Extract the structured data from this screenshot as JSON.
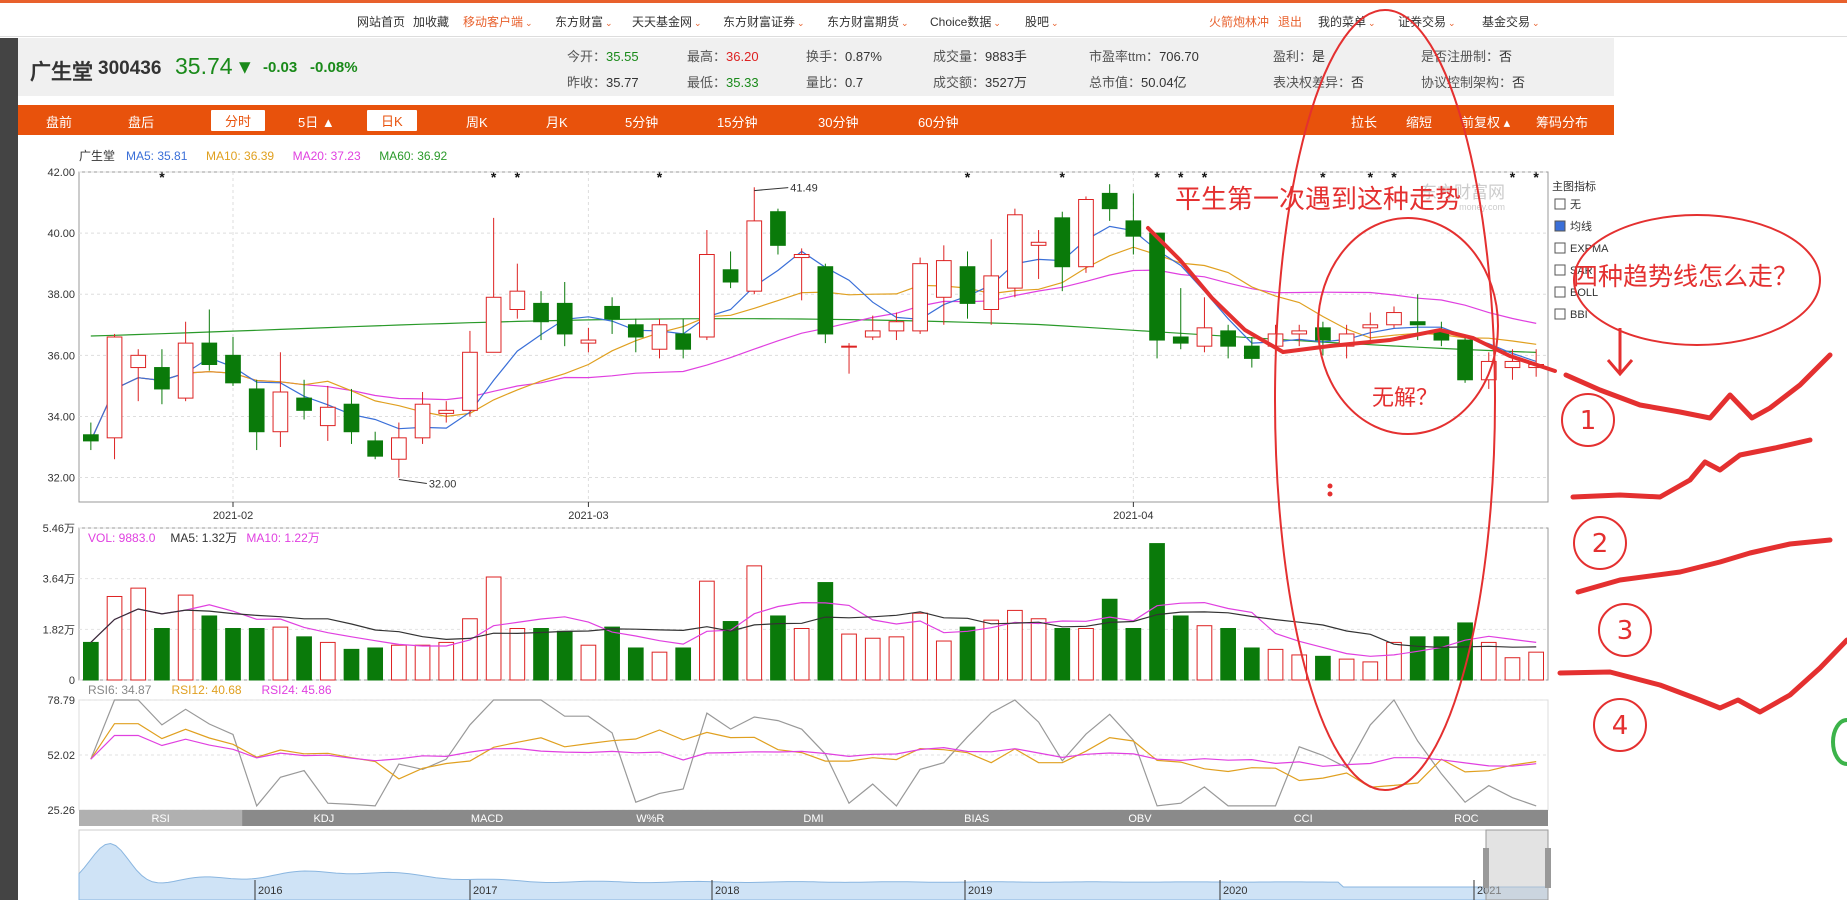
{
  "nav": {
    "items": [
      {
        "label": "网站首页",
        "x": 357
      },
      {
        "label": "加收藏",
        "x": 413
      },
      {
        "label": "移动客户端",
        "x": 463,
        "hot": true,
        "caret": true
      },
      {
        "label": "东方财富",
        "x": 555,
        "caret": true
      },
      {
        "label": "天天基金网",
        "x": 632,
        "caret": true
      },
      {
        "label": "东方财富证券",
        "x": 723,
        "caret": true
      },
      {
        "label": "东方财富期货",
        "x": 827,
        "caret": true
      },
      {
        "label": "Choice数据",
        "x": 930,
        "caret": true
      },
      {
        "label": "股吧",
        "x": 1025,
        "caret": true
      },
      {
        "label": "火箭炮林冲",
        "x": 1209,
        "hot": true
      },
      {
        "label": "退出",
        "x": 1278,
        "hot": true
      },
      {
        "label": "我的菜单",
        "x": 1318,
        "caret": true
      },
      {
        "label": "证券交易",
        "x": 1398,
        "caret": true
      },
      {
        "label": "基金交易",
        "x": 1482,
        "caret": true
      }
    ]
  },
  "quote": {
    "name": "广生堂",
    "code": "300436",
    "price": "35.74",
    "change": "-0.03",
    "change_pct": "-0.08%",
    "fields": [
      {
        "label": "今开：",
        "value": "35.55",
        "color": "green",
        "col": 0,
        "row": 0
      },
      {
        "label": "昨收：",
        "value": "35.77",
        "color": "",
        "col": 0,
        "row": 1
      },
      {
        "label": "最高：",
        "value": "36.20",
        "color": "red",
        "col": 1,
        "row": 0
      },
      {
        "label": "最低：",
        "value": "35.33",
        "color": "green",
        "col": 1,
        "row": 1
      },
      {
        "label": "换手：",
        "value": "0.87%",
        "color": "",
        "col": 2,
        "row": 0
      },
      {
        "label": "量比：",
        "value": "0.7",
        "color": "",
        "col": 2,
        "row": 1
      },
      {
        "label": "成交量：",
        "value": "9883手",
        "color": "",
        "col": 3,
        "row": 0
      },
      {
        "label": "成交额：",
        "value": "3527万",
        "color": "",
        "col": 3,
        "row": 1
      },
      {
        "label": "市盈率ttm：",
        "value": "706.70",
        "color": "",
        "col": 4,
        "row": 0
      },
      {
        "label": "总市值：",
        "value": "50.04亿",
        "color": "",
        "col": 4,
        "row": 1
      },
      {
        "label": "盈利：",
        "value": "是",
        "color": "",
        "col": 5,
        "row": 0
      },
      {
        "label": "表决权差异：",
        "value": "否",
        "color": "",
        "col": 5,
        "row": 1
      },
      {
        "label": "是否注册制：",
        "value": "否",
        "color": "",
        "col": 6,
        "row": 0
      },
      {
        "label": "协议控制架构：",
        "value": "否",
        "color": "",
        "col": 6,
        "row": 1
      }
    ]
  },
  "tabs": [
    {
      "label": "盘前",
      "x": 28
    },
    {
      "label": "盘后",
      "x": 110
    },
    {
      "label": "分时",
      "x": 193,
      "active": true
    },
    {
      "label": "5日 ▲",
      "x": 280
    },
    {
      "label": "日K",
      "x": 349,
      "active": true
    },
    {
      "label": "周K",
      "x": 448
    },
    {
      "label": "月K",
      "x": 528
    },
    {
      "label": "5分钟",
      "x": 607
    },
    {
      "label": "15分钟",
      "x": 699
    },
    {
      "label": "30分钟",
      "x": 800
    },
    {
      "label": "60分钟",
      "x": 900
    },
    {
      "label": "拉长",
      "x": 1333
    },
    {
      "label": "缩短",
      "x": 1388
    },
    {
      "label": "前复权 ▴",
      "x": 1443
    },
    {
      "label": "筹码分布",
      "x": 1518
    }
  ],
  "legend": {
    "name": "广生堂",
    "ma": [
      {
        "text": "MA5: 35.81",
        "color": "#3a6fd8"
      },
      {
        "text": "MA10: 36.39",
        "color": "#e0a020"
      },
      {
        "text": "MA20: 37.23",
        "color": "#e040e0"
      },
      {
        "text": "MA60: 36.92",
        "color": "#2a9a2a"
      }
    ],
    "vol": [
      {
        "text": "VOL: 9883.0",
        "color": "#e040e0"
      },
      {
        "text": "MA5: 1.32万",
        "color": "#333333"
      },
      {
        "text": "MA10: 1.22万",
        "color": "#e040e0"
      }
    ],
    "rsi": [
      {
        "text": "RSI6: 34.87",
        "color": "#888888"
      },
      {
        "text": "RSI12: 40.68",
        "color": "#e0a020"
      },
      {
        "text": "RSI24: 45.86",
        "color": "#e040e0"
      }
    ]
  },
  "side_panel": {
    "title": "主图指标",
    "options": [
      {
        "label": "无",
        "checked": false
      },
      {
        "label": "均线",
        "checked": true
      },
      {
        "label": "EXPMA",
        "checked": false
      },
      {
        "label": "SAR",
        "checked": false
      },
      {
        "label": "BOLL",
        "checked": false
      },
      {
        "label": "BBI",
        "checked": false
      }
    ]
  },
  "indicator_tabs": [
    "RSI",
    "KDJ",
    "MACD",
    "W%R",
    "DMI",
    "BIAS",
    "OBV",
    "CCI",
    "ROC"
  ],
  "overview_years": [
    "2016",
    "2017",
    "2018",
    "2019",
    "2020",
    "2021"
  ],
  "watermark": "东方财富网",
  "watermark_sub": "money.com",
  "annotations": {
    "top_text": "平生第一次遇到这种走势",
    "mid_text": "无解？",
    "question": "四种趋势线怎么走？",
    "nums": [
      "1",
      "2",
      "3",
      "4"
    ]
  },
  "chart_data": {
    "type": "candlestick",
    "x_labels": [
      "2021-02",
      "2021-03",
      "2021-04"
    ],
    "x_label_index": [
      6,
      21,
      44
    ],
    "price_axis": {
      "ticks": [
        32.0,
        34.0,
        36.0,
        38.0,
        40.0,
        42.0
      ],
      "ylim": [
        31.2,
        42.0
      ]
    },
    "high_label": "41.49",
    "low_label": "32.00",
    "candles": [
      [
        33.4,
        33.2,
        33.8,
        32.9
      ],
      [
        33.3,
        36.6,
        36.7,
        32.6
      ],
      [
        35.6,
        36.0,
        36.2,
        34.5
      ],
      [
        35.6,
        34.9,
        36.2,
        34.4
      ],
      [
        34.6,
        36.4,
        37.1,
        34.5
      ],
      [
        36.4,
        35.7,
        37.5,
        35.5
      ],
      [
        36.0,
        35.1,
        36.6,
        35.0
      ],
      [
        34.9,
        33.5,
        35.2,
        32.9
      ],
      [
        33.5,
        34.8,
        36.1,
        33.0
      ],
      [
        34.6,
        34.2,
        35.2,
        33.9
      ],
      [
        33.7,
        34.3,
        35.0,
        33.2
      ],
      [
        34.4,
        33.5,
        34.9,
        33.1
      ],
      [
        33.2,
        32.7,
        33.5,
        32.6
      ],
      [
        32.6,
        33.3,
        33.8,
        32.0
      ],
      [
        33.3,
        34.4,
        34.8,
        33.1
      ],
      [
        34.1,
        34.2,
        34.5,
        33.8
      ],
      [
        34.2,
        36.1,
        36.8,
        34.0
      ],
      [
        36.1,
        37.9,
        40.5,
        36.1
      ],
      [
        37.5,
        38.1,
        39.0,
        37.2
      ],
      [
        37.7,
        37.1,
        38.1,
        36.5
      ],
      [
        37.7,
        36.7,
        38.4,
        36.3
      ],
      [
        36.4,
        36.5,
        36.9,
        36.1
      ],
      [
        37.6,
        37.2,
        37.9,
        36.7
      ],
      [
        37.0,
        36.6,
        37.2,
        36.1
      ],
      [
        36.2,
        37.0,
        37.2,
        35.9
      ],
      [
        36.7,
        36.2,
        37.2,
        35.9
      ],
      [
        36.6,
        39.3,
        40.1,
        36.5
      ],
      [
        38.8,
        38.4,
        39.4,
        38.2
      ],
      [
        38.1,
        40.4,
        41.5,
        38.0
      ],
      [
        40.7,
        39.6,
        40.8,
        39.3
      ],
      [
        39.2,
        39.3,
        39.5,
        37.8
      ],
      [
        38.9,
        36.7,
        39.0,
        36.4
      ],
      [
        36.3,
        36.3,
        36.4,
        35.4
      ],
      [
        36.6,
        36.8,
        37.3,
        36.5
      ],
      [
        36.8,
        37.1,
        37.4,
        36.5
      ],
      [
        36.8,
        39.0,
        39.2,
        36.7
      ],
      [
        37.9,
        39.1,
        39.6,
        37.0
      ],
      [
        38.9,
        37.7,
        39.4,
        37.2
      ],
      [
        37.5,
        38.6,
        39.8,
        37.0
      ],
      [
        38.2,
        40.6,
        40.8,
        37.9
      ],
      [
        39.6,
        39.7,
        40.1,
        38.5
      ],
      [
        40.5,
        38.9,
        40.7,
        38.1
      ],
      [
        38.9,
        41.1,
        41.2,
        38.7
      ],
      [
        41.3,
        40.8,
        41.6,
        40.4
      ],
      [
        40.4,
        39.9,
        41.3,
        39.3
      ],
      [
        40.0,
        36.5,
        40.0,
        35.9
      ],
      [
        36.6,
        36.4,
        38.2,
        36.2
      ],
      [
        36.3,
        36.9,
        37.9,
        36.1
      ],
      [
        36.8,
        36.3,
        37.0,
        35.9
      ],
      [
        36.3,
        35.9,
        36.6,
        35.6
      ],
      [
        36.3,
        36.7,
        37.0,
        35.6
      ],
      [
        36.7,
        36.8,
        37.0,
        36.3
      ],
      [
        36.9,
        36.5,
        37.1,
        36.0
      ],
      [
        36.3,
        36.7,
        37.0,
        35.9
      ],
      [
        36.9,
        37.0,
        37.4,
        36.5
      ],
      [
        37.0,
        37.4,
        37.6,
        36.9
      ],
      [
        37.1,
        37.0,
        38.0,
        36.5
      ],
      [
        36.8,
        36.5,
        37.1,
        36.3
      ],
      [
        36.5,
        35.2,
        36.6,
        35.1
      ],
      [
        35.2,
        35.8,
        36.1,
        34.9
      ],
      [
        35.6,
        35.8,
        36.2,
        35.2
      ],
      [
        35.6,
        35.7,
        36.2,
        35.3
      ]
    ],
    "volume_axis": {
      "ticks": [
        "0",
        "1.82万",
        "3.64万",
        "5.46万"
      ]
    },
    "volume": [
      1.35,
      3.0,
      3.3,
      1.85,
      3.05,
      2.3,
      1.85,
      1.85,
      1.9,
      1.55,
      1.35,
      1.1,
      1.15,
      1.25,
      1.25,
      1.35,
      2.2,
      3.7,
      1.85,
      1.85,
      1.75,
      1.25,
      1.9,
      1.15,
      1.0,
      1.15,
      3.55,
      2.1,
      4.1,
      2.3,
      1.85,
      3.5,
      1.65,
      1.5,
      1.55,
      2.4,
      1.4,
      1.9,
      2.15,
      2.5,
      2.2,
      1.85,
      1.85,
      2.9,
      1.85,
      4.9,
      2.3,
      1.95,
      1.85,
      1.15,
      1.1,
      0.9,
      0.85,
      0.75,
      0.65,
      1.35,
      1.55,
      1.55,
      2.05,
      1.35,
      0.8,
      1.0
    ],
    "rsi_axis": {
      "ticks": [
        "25.26",
        "52.02",
        "78.79"
      ]
    }
  }
}
